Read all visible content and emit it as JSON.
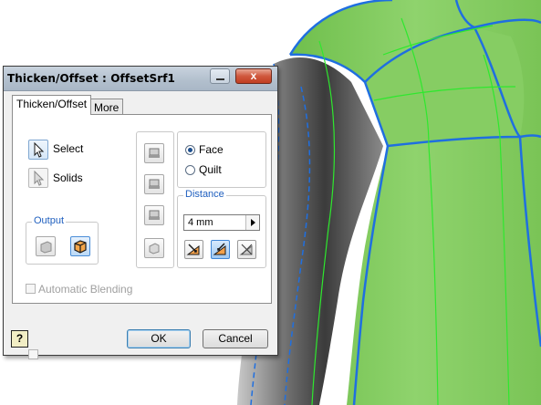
{
  "dialog": {
    "title": "Thicken/Offset : OffsetSrf1",
    "close_symbol": "x",
    "tabs": [
      {
        "label": "Thicken/Offset",
        "active": true
      },
      {
        "label": "More",
        "active": false
      }
    ],
    "select_label": "Select",
    "solids_label": "Solids",
    "output_title": "Output",
    "face_label": "Face",
    "quilt_label": "Quilt",
    "selection_mode": "Face",
    "distance_title": "Distance",
    "distance_value": "4 mm",
    "auto_blend_label": "Automatic Blending",
    "ok_label": "OK",
    "cancel_label": "Cancel",
    "help_symbol": "?"
  },
  "icons": [
    "select-arrow-icon",
    "solids-arrow-icon",
    "output-solid-icon",
    "output-surface-icon",
    "chain-icon",
    "direction-icon",
    "help-icon"
  ],
  "colors": {
    "model_green": "#7cc45a",
    "edge_blue": "#1f6fe0",
    "wire_green": "#2ee82e",
    "dialog_bg": "#f0f0f0",
    "accent_blue": "#1f5fbf"
  }
}
